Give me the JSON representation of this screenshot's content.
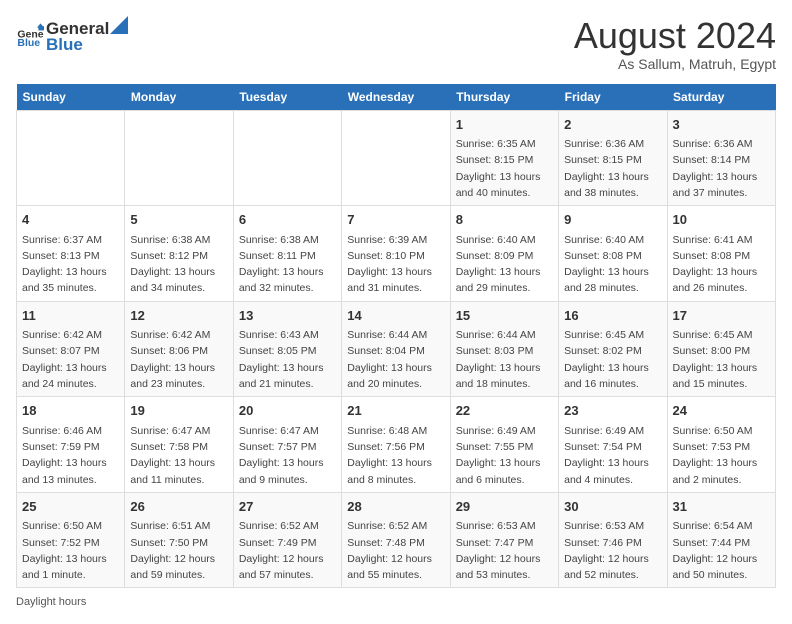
{
  "header": {
    "logo_general": "General",
    "logo_blue": "Blue",
    "main_title": "August 2024",
    "subtitle": "As Sallum, Matruh, Egypt"
  },
  "days_of_week": [
    "Sunday",
    "Monday",
    "Tuesday",
    "Wednesday",
    "Thursday",
    "Friday",
    "Saturday"
  ],
  "weeks": [
    [
      {
        "num": "",
        "info": ""
      },
      {
        "num": "",
        "info": ""
      },
      {
        "num": "",
        "info": ""
      },
      {
        "num": "",
        "info": ""
      },
      {
        "num": "1",
        "info": "Sunrise: 6:35 AM\nSunset: 8:15 PM\nDaylight: 13 hours\nand 40 minutes."
      },
      {
        "num": "2",
        "info": "Sunrise: 6:36 AM\nSunset: 8:15 PM\nDaylight: 13 hours\nand 38 minutes."
      },
      {
        "num": "3",
        "info": "Sunrise: 6:36 AM\nSunset: 8:14 PM\nDaylight: 13 hours\nand 37 minutes."
      }
    ],
    [
      {
        "num": "4",
        "info": "Sunrise: 6:37 AM\nSunset: 8:13 PM\nDaylight: 13 hours\nand 35 minutes."
      },
      {
        "num": "5",
        "info": "Sunrise: 6:38 AM\nSunset: 8:12 PM\nDaylight: 13 hours\nand 34 minutes."
      },
      {
        "num": "6",
        "info": "Sunrise: 6:38 AM\nSunset: 8:11 PM\nDaylight: 13 hours\nand 32 minutes."
      },
      {
        "num": "7",
        "info": "Sunrise: 6:39 AM\nSunset: 8:10 PM\nDaylight: 13 hours\nand 31 minutes."
      },
      {
        "num": "8",
        "info": "Sunrise: 6:40 AM\nSunset: 8:09 PM\nDaylight: 13 hours\nand 29 minutes."
      },
      {
        "num": "9",
        "info": "Sunrise: 6:40 AM\nSunset: 8:08 PM\nDaylight: 13 hours\nand 28 minutes."
      },
      {
        "num": "10",
        "info": "Sunrise: 6:41 AM\nSunset: 8:08 PM\nDaylight: 13 hours\nand 26 minutes."
      }
    ],
    [
      {
        "num": "11",
        "info": "Sunrise: 6:42 AM\nSunset: 8:07 PM\nDaylight: 13 hours\nand 24 minutes."
      },
      {
        "num": "12",
        "info": "Sunrise: 6:42 AM\nSunset: 8:06 PM\nDaylight: 13 hours\nand 23 minutes."
      },
      {
        "num": "13",
        "info": "Sunrise: 6:43 AM\nSunset: 8:05 PM\nDaylight: 13 hours\nand 21 minutes."
      },
      {
        "num": "14",
        "info": "Sunrise: 6:44 AM\nSunset: 8:04 PM\nDaylight: 13 hours\nand 20 minutes."
      },
      {
        "num": "15",
        "info": "Sunrise: 6:44 AM\nSunset: 8:03 PM\nDaylight: 13 hours\nand 18 minutes."
      },
      {
        "num": "16",
        "info": "Sunrise: 6:45 AM\nSunset: 8:02 PM\nDaylight: 13 hours\nand 16 minutes."
      },
      {
        "num": "17",
        "info": "Sunrise: 6:45 AM\nSunset: 8:00 PM\nDaylight: 13 hours\nand 15 minutes."
      }
    ],
    [
      {
        "num": "18",
        "info": "Sunrise: 6:46 AM\nSunset: 7:59 PM\nDaylight: 13 hours\nand 13 minutes."
      },
      {
        "num": "19",
        "info": "Sunrise: 6:47 AM\nSunset: 7:58 PM\nDaylight: 13 hours\nand 11 minutes."
      },
      {
        "num": "20",
        "info": "Sunrise: 6:47 AM\nSunset: 7:57 PM\nDaylight: 13 hours\nand 9 minutes."
      },
      {
        "num": "21",
        "info": "Sunrise: 6:48 AM\nSunset: 7:56 PM\nDaylight: 13 hours\nand 8 minutes."
      },
      {
        "num": "22",
        "info": "Sunrise: 6:49 AM\nSunset: 7:55 PM\nDaylight: 13 hours\nand 6 minutes."
      },
      {
        "num": "23",
        "info": "Sunrise: 6:49 AM\nSunset: 7:54 PM\nDaylight: 13 hours\nand 4 minutes."
      },
      {
        "num": "24",
        "info": "Sunrise: 6:50 AM\nSunset: 7:53 PM\nDaylight: 13 hours\nand 2 minutes."
      }
    ],
    [
      {
        "num": "25",
        "info": "Sunrise: 6:50 AM\nSunset: 7:52 PM\nDaylight: 13 hours\nand 1 minute."
      },
      {
        "num": "26",
        "info": "Sunrise: 6:51 AM\nSunset: 7:50 PM\nDaylight: 12 hours\nand 59 minutes."
      },
      {
        "num": "27",
        "info": "Sunrise: 6:52 AM\nSunset: 7:49 PM\nDaylight: 12 hours\nand 57 minutes."
      },
      {
        "num": "28",
        "info": "Sunrise: 6:52 AM\nSunset: 7:48 PM\nDaylight: 12 hours\nand 55 minutes."
      },
      {
        "num": "29",
        "info": "Sunrise: 6:53 AM\nSunset: 7:47 PM\nDaylight: 12 hours\nand 53 minutes."
      },
      {
        "num": "30",
        "info": "Sunrise: 6:53 AM\nSunset: 7:46 PM\nDaylight: 12 hours\nand 52 minutes."
      },
      {
        "num": "31",
        "info": "Sunrise: 6:54 AM\nSunset: 7:44 PM\nDaylight: 12 hours\nand 50 minutes."
      }
    ]
  ],
  "footer": {
    "daylight_label": "Daylight hours"
  }
}
